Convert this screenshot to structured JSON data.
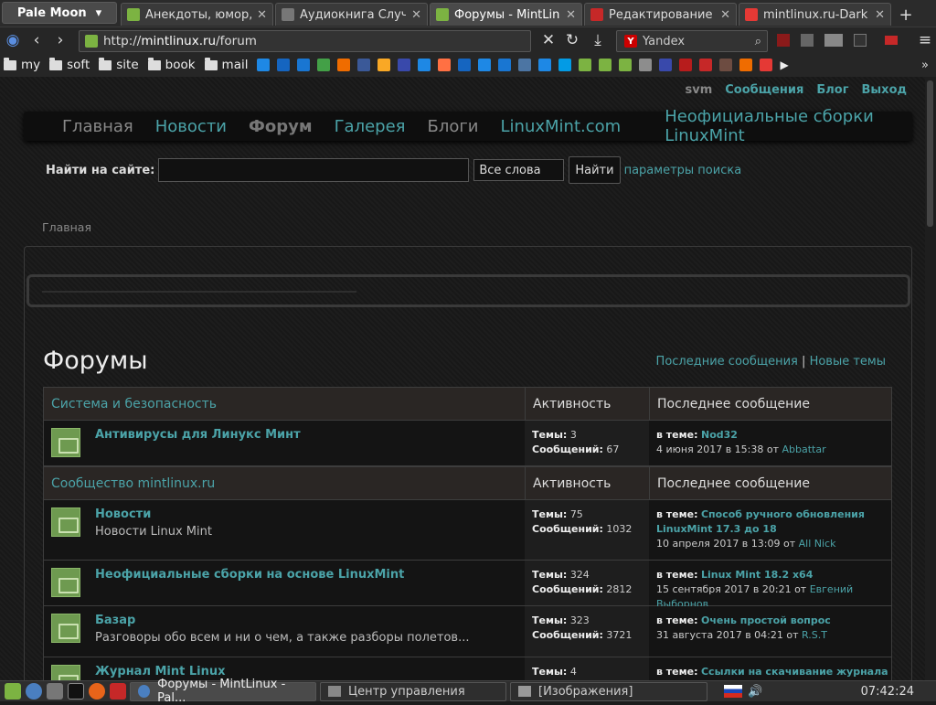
{
  "browser": {
    "app_button": "Pale Moon",
    "tabs": [
      {
        "title": "Анекдоты, юмор, ...",
        "color": "#7cb342"
      },
      {
        "title": "Аудиокнига Случа...",
        "color": "#777"
      },
      {
        "title": "Форумы - MintLinux",
        "color": "#7cb342",
        "active": true
      },
      {
        "title": "Редактирование '...",
        "color": "#c62828"
      },
      {
        "title": "mintlinux.ru-Dark | ...",
        "color": "#e53935"
      }
    ],
    "url_prefix": "http://",
    "url_domain": "mintlinux.ru",
    "url_path": "/forum",
    "search_engine": "Yandex",
    "bookmarks": [
      "my",
      "soft",
      "site",
      "book",
      "mail"
    ]
  },
  "site": {
    "userbar": {
      "user": "svm",
      "messages": "Сообщения",
      "blog": "Блог",
      "logout": "Выход"
    },
    "menu": [
      "Главная",
      "Новости",
      "Форум",
      "Галерея",
      "Блоги",
      "LinuxMint.com",
      "Неофициальные сборки LinuxMint"
    ],
    "search": {
      "label": "Найти на сайте:",
      "mode": "Все слова",
      "button": "Найти",
      "params": "параметры поиска"
    },
    "breadcrumb": "Главная",
    "forums_title": "Форумы",
    "last_posts": "Последние сообщения",
    "separator": "|",
    "new_topics": "Новые темы"
  },
  "table": {
    "activity": "Активность",
    "last_post": "Последнее сообщение",
    "topics_label": "Темы:",
    "posts_label": "Сообщений:",
    "in_topic": "в теме:",
    "sections": [
      {
        "name": "Система и безопасность",
        "rows": [
          {
            "name": "Антивирусы для Линукс Минт",
            "desc": "",
            "topics": "3",
            "posts": "67",
            "topic": "Nod32",
            "date": "4 июня 2017 в 15:38 от",
            "author": "Abbattar"
          }
        ]
      },
      {
        "name": "Сообщество mintlinux.ru",
        "rows": [
          {
            "name": "Новости",
            "desc": "Новости Linux Mint",
            "topics": "75",
            "posts": "1032",
            "topic": "Способ ручного обновления LinuxMint 17.3 до 18",
            "date": "10 апреля 2017 в 13:09 от",
            "author": "All Nick"
          },
          {
            "name": "Неофициальные сборки на основе LinuxMint",
            "desc": "",
            "topics": "324",
            "posts": "2812",
            "topic": "Linux Mint 18.2 x64",
            "date": "15 сентября 2017 в 20:21 от",
            "author": "Евгений Выборнов"
          },
          {
            "name": "Базар",
            "desc": "Разговоры обо всем и ни о чем, а также разборы полетов...",
            "topics": "323",
            "posts": "3721",
            "topic": "Очень простой вопрос",
            "date": "31 августа 2017 в 04:21 от",
            "author": "R.S.T"
          },
          {
            "name": "Журнал Mint Linux",
            "desc": "",
            "topics": "4",
            "posts": "",
            "topic": "Ссылки на скачивание журнала",
            "date": "",
            "author": ""
          }
        ]
      }
    ]
  },
  "taskbar": {
    "tasks": [
      "Форумы - MintLinux - Pal...",
      "Центр управления",
      "[Изображения]"
    ],
    "clock": "07:42:24"
  }
}
